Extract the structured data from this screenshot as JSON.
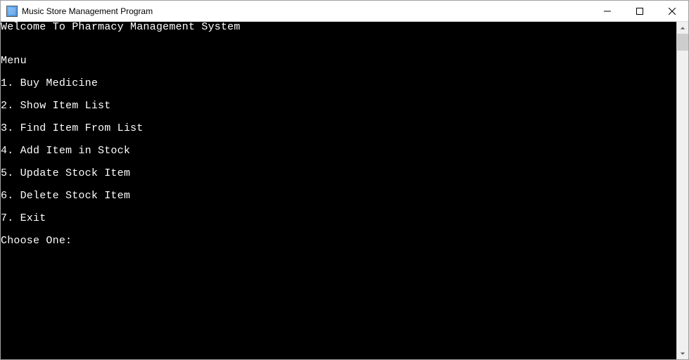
{
  "window": {
    "title": "Music Store Management Program"
  },
  "console": {
    "lines": [
      "Welcome To Pharmacy Management System",
      "",
      "Menu",
      "1. Buy Medicine",
      "2. Show Item List",
      "3. Find Item From List",
      "4. Add Item in Stock",
      "5. Update Stock Item",
      "6. Delete Stock Item",
      "7. Exit",
      "Choose One:"
    ]
  }
}
